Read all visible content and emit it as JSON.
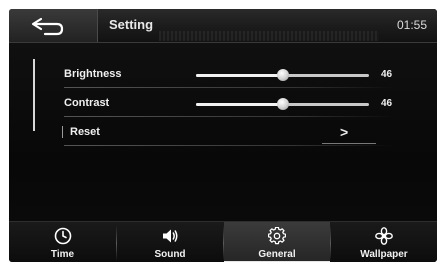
{
  "header": {
    "back_icon": "back-arrow-icon",
    "title": "Setting",
    "clock": "01:55"
  },
  "settings": {
    "brightness": {
      "label": "Brightness",
      "value": "46",
      "level": 0.5
    },
    "contrast": {
      "label": "Contrast",
      "value": "46",
      "level": 0.5
    },
    "reset": {
      "label": "Reset",
      "action_icon": "chevron-right-icon",
      "action_glyph": ">"
    }
  },
  "tabs": [
    {
      "label": "Time",
      "icon": "clock-icon",
      "active": false
    },
    {
      "label": "Sound",
      "icon": "speaker-icon",
      "active": false
    },
    {
      "label": "General",
      "icon": "gear-icon",
      "active": true
    },
    {
      "label": "Wallpaper",
      "icon": "flower-icon",
      "active": false
    }
  ],
  "colors": {
    "background": "#0a0a0a",
    "text": "#ffffff",
    "slider_track": "#c8c8c8",
    "active_tab": "#333333"
  }
}
